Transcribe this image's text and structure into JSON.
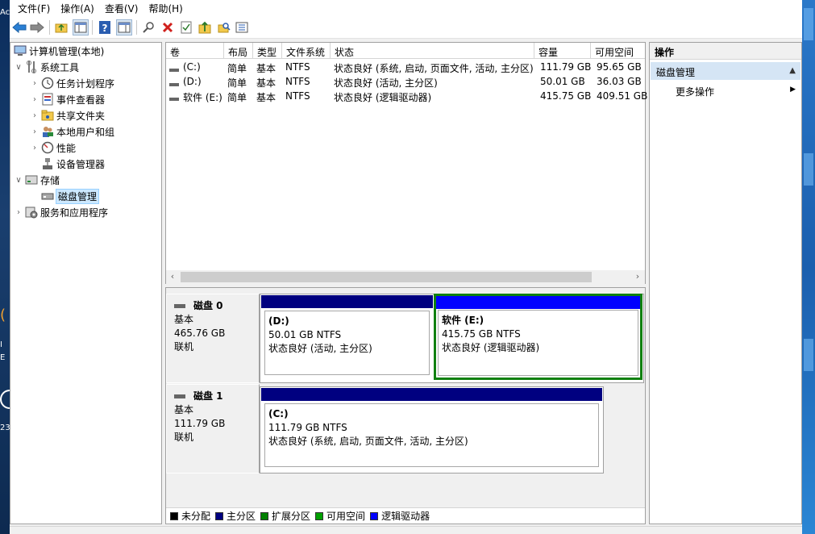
{
  "menu": [
    "文件(F)",
    "操作(A)",
    "查看(V)",
    "帮助(H)"
  ],
  "desktop_left": [
    "Ac",
    "I",
    "E",
    "23"
  ],
  "tree": {
    "root": "计算机管理(本地)",
    "system_tools": "系统工具",
    "task_scheduler": "任务计划程序",
    "event_viewer": "事件查看器",
    "shared_folders": "共享文件夹",
    "local_users": "本地用户和组",
    "performance": "性能",
    "device_manager": "设备管理器",
    "storage": "存储",
    "disk_management": "磁盘管理",
    "services_apps": "服务和应用程序"
  },
  "volumes": {
    "columns": [
      "卷",
      "布局",
      "类型",
      "文件系统",
      "状态",
      "容量",
      "可用空间"
    ],
    "rows": [
      {
        "vol": "(C:)",
        "layout": "简单",
        "type": "基本",
        "fs": "NTFS",
        "status": "状态良好 (系统, 启动, 页面文件, 活动, 主分区)",
        "capacity": "111.79 GB",
        "free": "95.65 GB"
      },
      {
        "vol": "(D:)",
        "layout": "简单",
        "type": "基本",
        "fs": "NTFS",
        "status": "状态良好 (活动, 主分区)",
        "capacity": "50.01 GB",
        "free": "36.03 GB"
      },
      {
        "vol": "软件 (E:)",
        "layout": "简单",
        "type": "基本",
        "fs": "NTFS",
        "status": "状态良好 (逻辑驱动器)",
        "capacity": "415.75 GB",
        "free": "409.51 GB"
      }
    ]
  },
  "disks": [
    {
      "name": "磁盘 0",
      "type": "基本",
      "size": "465.76 GB",
      "state": "联机",
      "partitions": [
        {
          "name": "(D:)",
          "size": "50.01 GB NTFS",
          "status": "状态良好 (活动, 主分区)",
          "color": "#000080"
        },
        {
          "name": "软件 (E:)",
          "size": "415.75 GB NTFS",
          "status": "状态良好 (逻辑驱动器)",
          "color": "#0000ff"
        }
      ]
    },
    {
      "name": "磁盘 1",
      "type": "基本",
      "size": "111.79 GB",
      "state": "联机",
      "partitions": [
        {
          "name": "(C:)",
          "size": "111.79 GB NTFS",
          "status": "状态良好 (系统, 启动, 页面文件, 活动, 主分区)",
          "color": "#000080"
        }
      ]
    }
  ],
  "legend": [
    {
      "label": "未分配",
      "color": "#000000"
    },
    {
      "label": "主分区",
      "color": "#000080"
    },
    {
      "label": "扩展分区",
      "color": "#008000"
    },
    {
      "label": "可用空间",
      "color": "#00a000"
    },
    {
      "label": "逻辑驱动器",
      "color": "#0000ff"
    }
  ],
  "actions": {
    "header": "操作",
    "section": "磁盘管理",
    "more": "更多操作"
  },
  "colors": {
    "selection_border": "#108010",
    "tree_selection": "#cce8ff"
  }
}
